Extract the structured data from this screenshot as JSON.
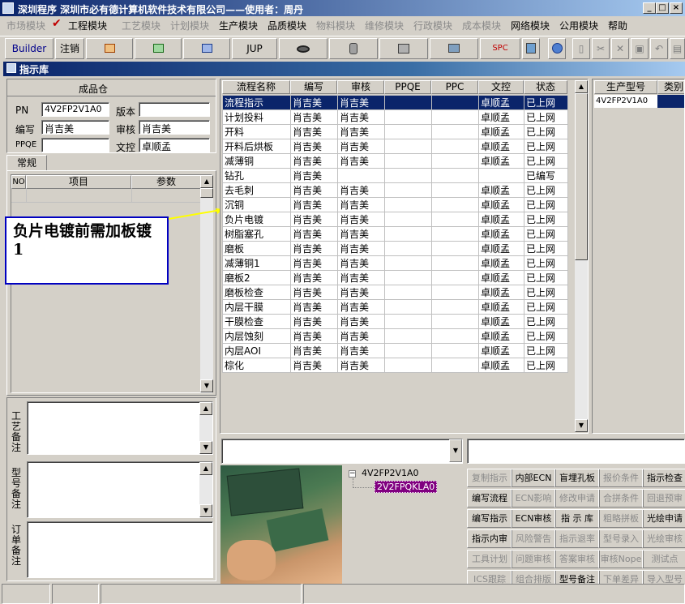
{
  "window": {
    "title": "深圳程序   深圳市必有德计算机软件技术有限公司——使用者：周丹",
    "min": "_",
    "max": "□",
    "close": "×"
  },
  "menus": [
    {
      "label": "市场模块",
      "enabled": false
    },
    {
      "label": "工程模块",
      "enabled": true,
      "checked": true
    },
    {
      "label": "工艺模块",
      "enabled": false
    },
    {
      "label": "计划模块",
      "enabled": false
    },
    {
      "label": "生产模块",
      "enabled": true
    },
    {
      "label": "品质模块",
      "enabled": true
    },
    {
      "label": "物料模块",
      "enabled": false
    },
    {
      "label": "维修模块",
      "enabled": false
    },
    {
      "label": "行政模块",
      "enabled": false
    },
    {
      "label": "成本模块",
      "enabled": false
    },
    {
      "label": "网络模块",
      "enabled": true
    },
    {
      "label": "公用模块",
      "enabled": true
    },
    {
      "label": "帮助",
      "enabled": true
    }
  ],
  "toolbar": {
    "builder": "Builder",
    "logout": "注销",
    "jup": "JUP",
    "spc": "SPC"
  },
  "panel": {
    "title": "指示库"
  },
  "product": {
    "warehouse": "成品仓",
    "pn_label": "PN",
    "pn_value": "4V2FP2V1A0",
    "version_label": "版本",
    "version_value": "",
    "author_label": "编写",
    "author_value": "肖吉美",
    "review_label": "审核",
    "review_value": "肖吉美",
    "ppqe_label": "PPQE",
    "ppqe_value": "",
    "doc_label": "文控",
    "doc_value": "卓顺孟"
  },
  "tabs": {
    "general": "常规"
  },
  "param_table": {
    "headers": [
      "NO",
      "项目",
      "参数"
    ]
  },
  "callout": {
    "text": "负片电镀前需加板镀1"
  },
  "remarks": {
    "process": "工艺备注",
    "model": "型号备注",
    "order": "订单备注"
  },
  "flow_table": {
    "headers": [
      "流程名称",
      "编写",
      "审核",
      "PPQE",
      "PPC",
      "文控",
      "状态"
    ],
    "rows": [
      [
        "流程指示",
        "肖吉美",
        "肖吉美",
        "",
        "",
        "卓顺孟",
        "已上网"
      ],
      [
        "计划投料",
        "肖吉美",
        "肖吉美",
        "",
        "",
        "卓顺孟",
        "已上网"
      ],
      [
        "开料",
        "肖吉美",
        "肖吉美",
        "",
        "",
        "卓顺孟",
        "已上网"
      ],
      [
        "开料后烘板",
        "肖吉美",
        "肖吉美",
        "",
        "",
        "卓顺孟",
        "已上网"
      ],
      [
        "减薄铜",
        "肖吉美",
        "肖吉美",
        "",
        "",
        "卓顺孟",
        "已上网"
      ],
      [
        "钻孔",
        "肖吉美",
        "",
        "",
        "",
        "",
        "已编写"
      ],
      [
        "去毛刺",
        "肖吉美",
        "肖吉美",
        "",
        "",
        "卓顺孟",
        "已上网"
      ],
      [
        "沉铜",
        "肖吉美",
        "肖吉美",
        "",
        "",
        "卓顺孟",
        "已上网"
      ],
      [
        "负片电镀",
        "肖吉美",
        "肖吉美",
        "",
        "",
        "卓顺孟",
        "已上网"
      ],
      [
        "树脂塞孔",
        "肖吉美",
        "肖吉美",
        "",
        "",
        "卓顺孟",
        "已上网"
      ],
      [
        "磨板",
        "肖吉美",
        "肖吉美",
        "",
        "",
        "卓顺孟",
        "已上网"
      ],
      [
        "减薄铜1",
        "肖吉美",
        "肖吉美",
        "",
        "",
        "卓顺孟",
        "已上网"
      ],
      [
        "磨板2",
        "肖吉美",
        "肖吉美",
        "",
        "",
        "卓顺孟",
        "已上网"
      ],
      [
        "磨板检查",
        "肖吉美",
        "肖吉美",
        "",
        "",
        "卓顺孟",
        "已上网"
      ],
      [
        "内层干膜",
        "肖吉美",
        "肖吉美",
        "",
        "",
        "卓顺孟",
        "已上网"
      ],
      [
        "干膜检查",
        "肖吉美",
        "肖吉美",
        "",
        "",
        "卓顺孟",
        "已上网"
      ],
      [
        "内层蚀刻",
        "肖吉美",
        "肖吉美",
        "",
        "",
        "卓顺孟",
        "已上网"
      ],
      [
        "内层AOI",
        "肖吉美",
        "肖吉美",
        "",
        "",
        "卓顺孟",
        "已上网"
      ],
      [
        "棕化",
        "肖吉美",
        "肖吉美",
        "",
        "",
        "卓顺孟",
        "已上网"
      ]
    ]
  },
  "model_table": {
    "headers": [
      "生产型号",
      "类别"
    ],
    "rows": [
      [
        "4V2FP2V1A0",
        ""
      ]
    ]
  },
  "tree": {
    "root": "4V2FP2V1A0",
    "child": "2V2FPQKLA0",
    "expander": "−"
  },
  "func_buttons": [
    [
      {
        "label": "复制指示",
        "enabled": false
      },
      {
        "label": "内部ECN",
        "enabled": true
      },
      {
        "label": "盲埋孔板",
        "enabled": true
      },
      {
        "label": "报价条件",
        "enabled": false
      },
      {
        "label": "指示检查",
        "enabled": true
      }
    ],
    [
      {
        "label": "编写流程",
        "enabled": true
      },
      {
        "label": "ECN影响",
        "enabled": false
      },
      {
        "label": "修改申请",
        "enabled": false
      },
      {
        "label": "合拼条件",
        "enabled": false
      },
      {
        "label": "回退预审",
        "enabled": false
      }
    ],
    [
      {
        "label": "编写指示",
        "enabled": true
      },
      {
        "label": "ECN审核",
        "enabled": true
      },
      {
        "label": "指 示 库",
        "enabled": true
      },
      {
        "label": "粗略拼板",
        "enabled": false
      },
      {
        "label": "光绘申请",
        "enabled": true
      }
    ],
    [
      {
        "label": "指示内审",
        "enabled": true
      },
      {
        "label": "风险警告",
        "enabled": false
      },
      {
        "label": "指示退率",
        "enabled": false
      },
      {
        "label": "型号录入",
        "enabled": false
      },
      {
        "label": "光绘审核",
        "enabled": false
      }
    ],
    [
      {
        "label": "工具计划",
        "enabled": false
      },
      {
        "label": "问题审核",
        "enabled": false
      },
      {
        "label": "答案审核",
        "enabled": false
      },
      {
        "label": "审核Nope",
        "enabled": false
      },
      {
        "label": "测试点",
        "enabled": false
      }
    ],
    [
      {
        "label": "ICS跟踪",
        "enabled": false
      },
      {
        "label": "组合排版",
        "enabled": false
      },
      {
        "label": "型号备注",
        "enabled": true
      },
      {
        "label": "下单差异",
        "enabled": false
      },
      {
        "label": "导入型号",
        "enabled": false
      }
    ]
  ],
  "colors": {
    "title_start": "#0a246a",
    "title_end": "#a6caf0",
    "selection": "#0a246a",
    "callout_border": "#0000c0",
    "callout_arrow": "#ffff00"
  }
}
